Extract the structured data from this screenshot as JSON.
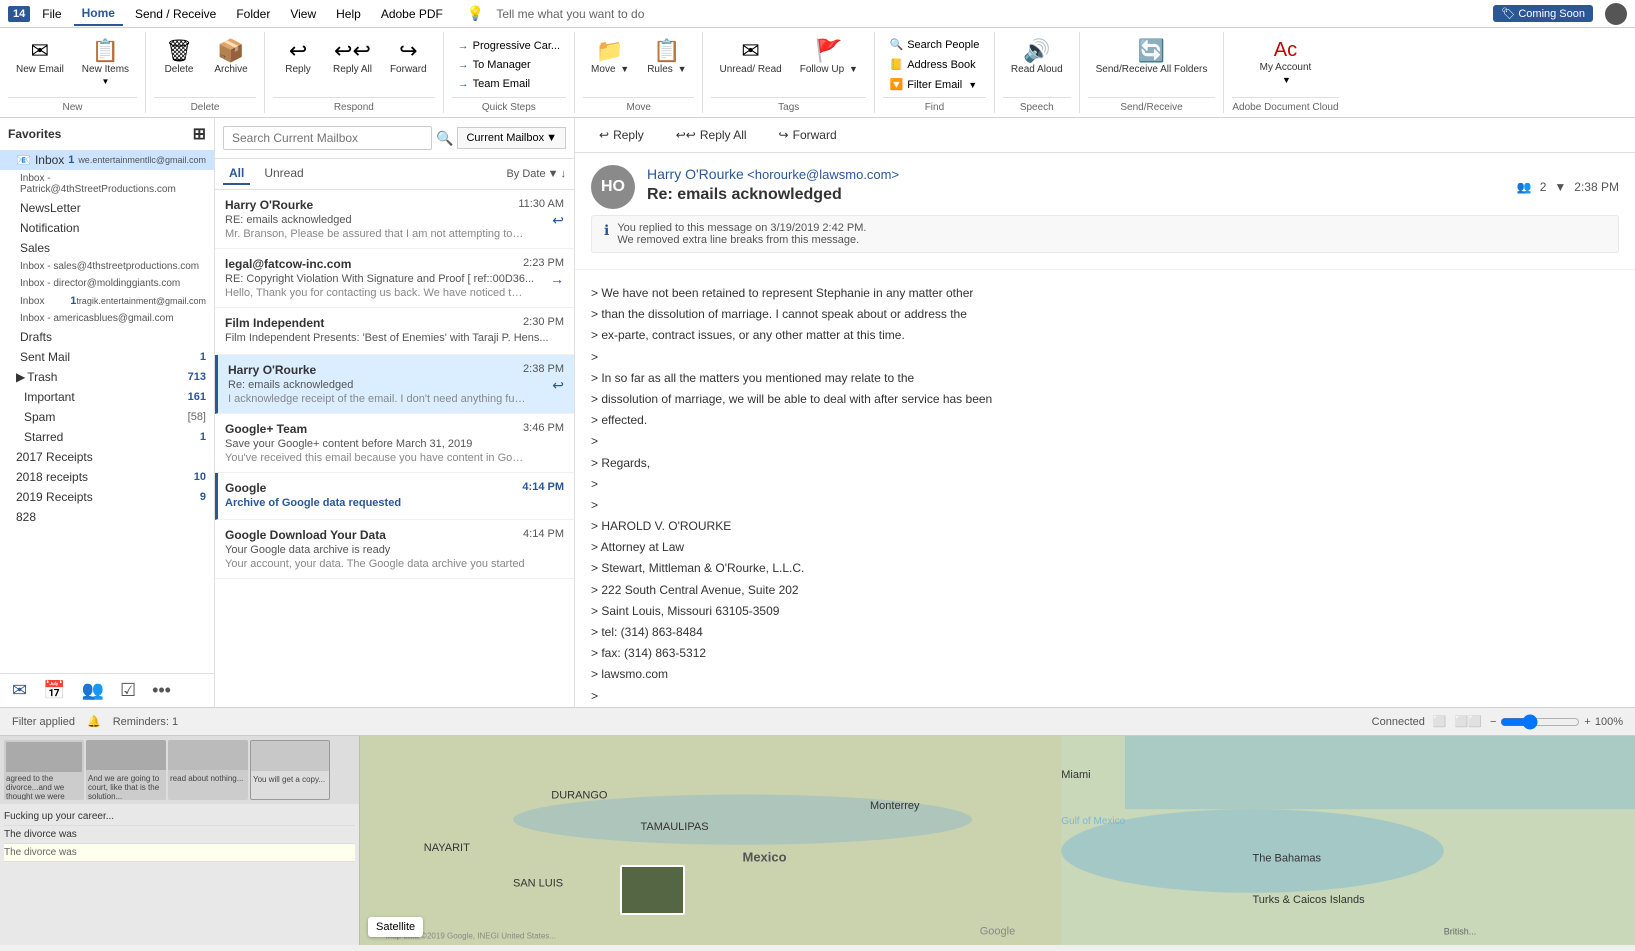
{
  "app": {
    "calendar_num": "14",
    "calendar_label": "Calendar"
  },
  "menubar": {
    "items": [
      "File",
      "Home",
      "Send / Receive",
      "Folder",
      "View",
      "Help",
      "Adobe PDF"
    ],
    "active": "Home",
    "tell_me": "Tell me what you want to do",
    "coming_soon": "Coming Soon"
  },
  "ribbon": {
    "groups": {
      "new": {
        "label": "New",
        "new_email_label": "New Email",
        "new_items_label": "New Items"
      },
      "delete": {
        "label": "Delete",
        "delete_label": "Delete",
        "archive_label": "Archive"
      },
      "respond": {
        "label": "Respond",
        "reply_label": "Reply",
        "reply_all_label": "Reply All",
        "forward_label": "Forward"
      },
      "quick_steps": {
        "label": "Quick Steps",
        "item1": "Progressive Car...",
        "item2": "To Manager",
        "item3": "Team Email"
      },
      "move": {
        "label": "Move",
        "move_label": "Move",
        "rules_label": "Rules"
      },
      "tags": {
        "label": "Tags",
        "unread_read_label": "Unread/ Read",
        "follow_up_label": "Follow Up"
      },
      "find": {
        "label": "Find",
        "search_people_label": "Search People",
        "address_book_label": "Address Book",
        "filter_email_label": "Filter Email"
      },
      "speech": {
        "label": "Speech",
        "read_aloud_label": "Read Aloud"
      },
      "send_receive": {
        "label": "Send/Receive",
        "send_receive_all_label": "Send/Receive All Folders"
      },
      "my_account": {
        "label": "Adobe Document Cloud",
        "my_account_label": "My Account"
      }
    }
  },
  "sidebar": {
    "favorites_label": "Favorites",
    "folders": [
      {
        "name": "Inbox",
        "count": "1",
        "email": "we.entertainmentllc@gmail.com",
        "active": true
      },
      {
        "name": "Inbox",
        "count": "",
        "email": "Patrick@4thStreetProductions.com"
      },
      {
        "name": "NewsLetter",
        "count": ""
      },
      {
        "name": "Notification",
        "count": ""
      },
      {
        "name": "Sales",
        "count": ""
      },
      {
        "name": "Inbox",
        "count": "",
        "email": "sales@4thstreetproductions.com"
      },
      {
        "name": "Inbox",
        "count": "",
        "email": "director@moldinggiants.com"
      },
      {
        "name": "Inbox",
        "count": "1",
        "email": "tragik.entertainment@gmail.com"
      },
      {
        "name": "Inbox",
        "count": "",
        "email": "americasblues@gmail.com"
      },
      {
        "name": "Drafts",
        "count": ""
      },
      {
        "name": "Sent Mail",
        "count": "1"
      },
      {
        "name": "Trash",
        "count": "713"
      },
      {
        "name": "Important",
        "count": "161"
      },
      {
        "name": "Spam",
        "count": "[58]"
      },
      {
        "name": "Starred",
        "count": "1"
      },
      {
        "name": "2017 Receipts",
        "count": ""
      },
      {
        "name": "2018 receipts",
        "count": "10"
      },
      {
        "name": "2019 Receipts",
        "count": "9"
      },
      {
        "name": "828",
        "count": ""
      }
    ]
  },
  "email_list": {
    "search_placeholder": "Search Current Mailbox",
    "search_scope": "Current Mailbox",
    "filter_all": "All",
    "filter_unread": "Unread",
    "sort_by": "By Date",
    "emails": [
      {
        "sender": "Harry O'Rourke",
        "subject": "RE: emails acknowledged",
        "preview": "Mr. Branson, Please be assured that I am not attempting to take",
        "time": "11:30 AM",
        "icon": "↩",
        "selected": false,
        "unread": false
      },
      {
        "sender": "legal@fatcow-inc.com",
        "subject": "RE: Copyright Violation With Signature and Proof   [ ref::00D36...",
        "preview": "Hello,  Thank you for contacting us back. We have noticed that",
        "time": "2:23 PM",
        "icon": "→",
        "selected": false,
        "unread": false
      },
      {
        "sender": "Film Independent",
        "subject": "Film Independent Presents: 'Best of Enemies' with Taraji P. Hens...",
        "preview": "",
        "time": "2:30 PM",
        "icon": "",
        "selected": false,
        "unread": false
      },
      {
        "sender": "Harry O'Rourke",
        "subject": "Re: emails acknowledged",
        "preview": "I acknowledge receipt of the email.  I don't need anything further",
        "time": "2:38 PM",
        "icon": "↩",
        "selected": true,
        "unread": false
      },
      {
        "sender": "Google+ Team",
        "subject": "Save your Google+ content before March 31, 2019",
        "preview": "You've received this email because you have content in Google+",
        "time": "3:46 PM",
        "icon": "",
        "selected": false,
        "unread": false
      },
      {
        "sender": "Google",
        "subject": "Archive of Google data requested",
        "preview": "",
        "time": "4:14 PM",
        "icon": "",
        "selected": false,
        "unread": false,
        "blue_accent": true
      },
      {
        "sender": "Google Download Your Data",
        "subject": "Your Google data archive is ready",
        "preview": "Your account, your data.  The Google data archive you started",
        "time": "4:14 PM",
        "icon": "",
        "selected": false,
        "unread": false
      }
    ]
  },
  "email_view": {
    "reply_label": "Reply",
    "reply_all_label": "Reply All",
    "forward_label": "Forward",
    "avatar_initials": "HO",
    "from_name": "Harry O'Rourke",
    "from_email": "<horourke@lawsmo.com>",
    "participants": "2",
    "time": "2:38 PM",
    "subject": "Re: emails acknowledged",
    "reply_notice_line1": "You replied to this message on 3/19/2019 2:42 PM.",
    "reply_notice_line2": "We removed extra line breaks from this message.",
    "body_lines": [
      "> We have not been retained to represent Stephanie in any matter other",
      "> than the dissolution of marriage. I cannot speak about or address the",
      "> ex-parte, contract issues, or any other matter at this time.",
      ">",
      "> In so far as all the matters you mentioned may relate to the",
      "> dissolution of marriage, we will be able to deal with after service has been",
      "> effected.",
      ">",
      "> Regards,",
      ">",
      ">",
      "> HAROLD V. O'ROURKE",
      "> Attorney at Law",
      "> Stewart, Mittleman & O'Rourke, L.L.C.",
      "> 222 South Central Avenue, Suite 202",
      "> Saint Louis, Missouri 63105-3509",
      "> tel: (314) 863-8484",
      "> fax: (314) 863-5312",
      "> lawsmo.com",
      ">"
    ]
  },
  "statusbar": {
    "filter_applied": "Filter applied",
    "reminders": "Reminders: 1",
    "connected": "Connected",
    "zoom": "100%"
  },
  "bottom": {
    "map_satellite": "Satellite",
    "chat_messages": [
      "agreed to the divorce...and we thought we were helping out both of you. There was never an attempt to hurt you...",
      "And we are going to court, like that is the solution...",
      "read about nothing...",
      "Fucking up your career...",
      "The divorce was..."
    ]
  }
}
